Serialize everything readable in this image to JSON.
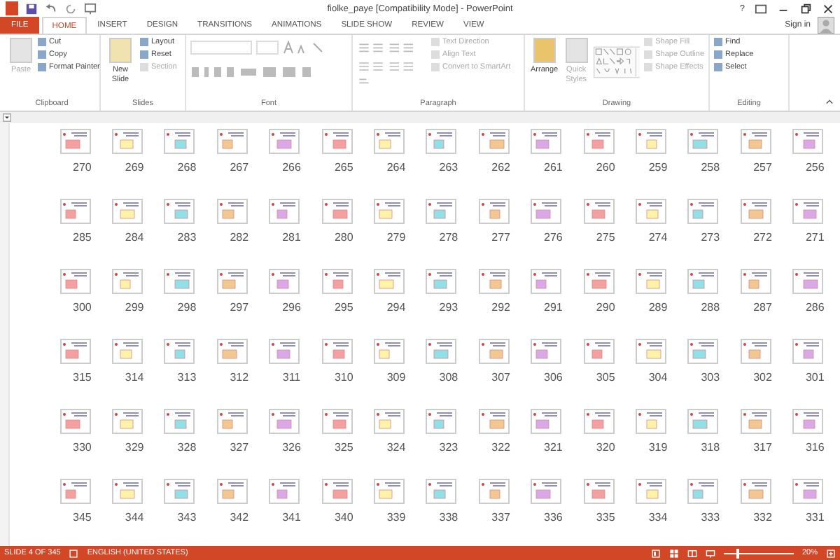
{
  "window": {
    "title": "fiolke_paye [Compatibility Mode] - PowerPoint",
    "help": "?"
  },
  "tabs": [
    {
      "label": "FILE",
      "kind": "file",
      "selected": false
    },
    {
      "label": "HOME",
      "kind": "tab",
      "selected": true
    },
    {
      "label": "INSERT",
      "kind": "tab",
      "selected": false
    },
    {
      "label": "DESIGN",
      "kind": "tab",
      "selected": false
    },
    {
      "label": "TRANSITIONS",
      "kind": "tab",
      "selected": false
    },
    {
      "label": "ANIMATIONS",
      "kind": "tab",
      "selected": false
    },
    {
      "label": "SLIDE SHOW",
      "kind": "tab",
      "selected": false
    },
    {
      "label": "REVIEW",
      "kind": "tab",
      "selected": false
    },
    {
      "label": "VIEW",
      "kind": "tab",
      "selected": false
    }
  ],
  "account": {
    "sign_in": "Sign in"
  },
  "ribbon": {
    "groups": [
      {
        "name": "Clipboard",
        "large": [
          {
            "label": "Paste",
            "disabled": true
          }
        ],
        "small": [
          {
            "label": "Cut",
            "disabled": false
          },
          {
            "label": "Copy",
            "disabled": false
          },
          {
            "label": "Format Painter",
            "disabled": false
          }
        ]
      },
      {
        "name": "Slides",
        "large": [
          {
            "label": "New Slide",
            "disabled": false
          }
        ],
        "small": [
          {
            "label": "Layout",
            "disabled": false
          },
          {
            "label": "Reset",
            "disabled": false
          },
          {
            "label": "Section",
            "disabled": true
          }
        ]
      },
      {
        "name": "Font"
      },
      {
        "name": "Paragraph",
        "small": [
          {
            "label": "Text Direction",
            "disabled": true
          },
          {
            "label": "Align Text",
            "disabled": true
          },
          {
            "label": "Convert to SmartArt",
            "disabled": true
          }
        ]
      },
      {
        "name": "Drawing",
        "large": [
          {
            "label": "Arrange",
            "disabled": false
          },
          {
            "label": "Quick Styles",
            "disabled": true
          }
        ],
        "small": [
          {
            "label": "Shape Fill",
            "disabled": true
          },
          {
            "label": "Shape Outline",
            "disabled": true
          },
          {
            "label": "Shape Effects",
            "disabled": true
          }
        ]
      },
      {
        "name": "Editing",
        "small": [
          {
            "label": "Find",
            "disabled": false
          },
          {
            "label": "Replace",
            "disabled": false
          },
          {
            "label": "Select",
            "disabled": false
          }
        ]
      }
    ]
  },
  "slides": [
    "270",
    "269",
    "268",
    "267",
    "266",
    "265",
    "264",
    "263",
    "262",
    "261",
    "260",
    "259",
    "258",
    "257",
    "256",
    "285",
    "284",
    "283",
    "282",
    "281",
    "280",
    "279",
    "278",
    "277",
    "276",
    "275",
    "274",
    "273",
    "272",
    "271",
    "300",
    "299",
    "298",
    "297",
    "296",
    "295",
    "294",
    "293",
    "292",
    "291",
    "290",
    "289",
    "288",
    "287",
    "286",
    "315",
    "314",
    "313",
    "312",
    "311",
    "310",
    "309",
    "308",
    "307",
    "306",
    "305",
    "304",
    "303",
    "302",
    "301",
    "330",
    "329",
    "328",
    "327",
    "326",
    "325",
    "324",
    "323",
    "322",
    "321",
    "320",
    "319",
    "318",
    "317",
    "316",
    "345",
    "344",
    "343",
    "342",
    "341",
    "340",
    "339",
    "338",
    "337",
    "336",
    "335",
    "334",
    "333",
    "332",
    "331"
  ],
  "status_bar": {
    "slide": "SLIDE 4 OF 345",
    "language": "ENGLISH (UNITED STATES)",
    "zoom": "20%",
    "zoom_slider": {
      "level": 0.2
    }
  }
}
